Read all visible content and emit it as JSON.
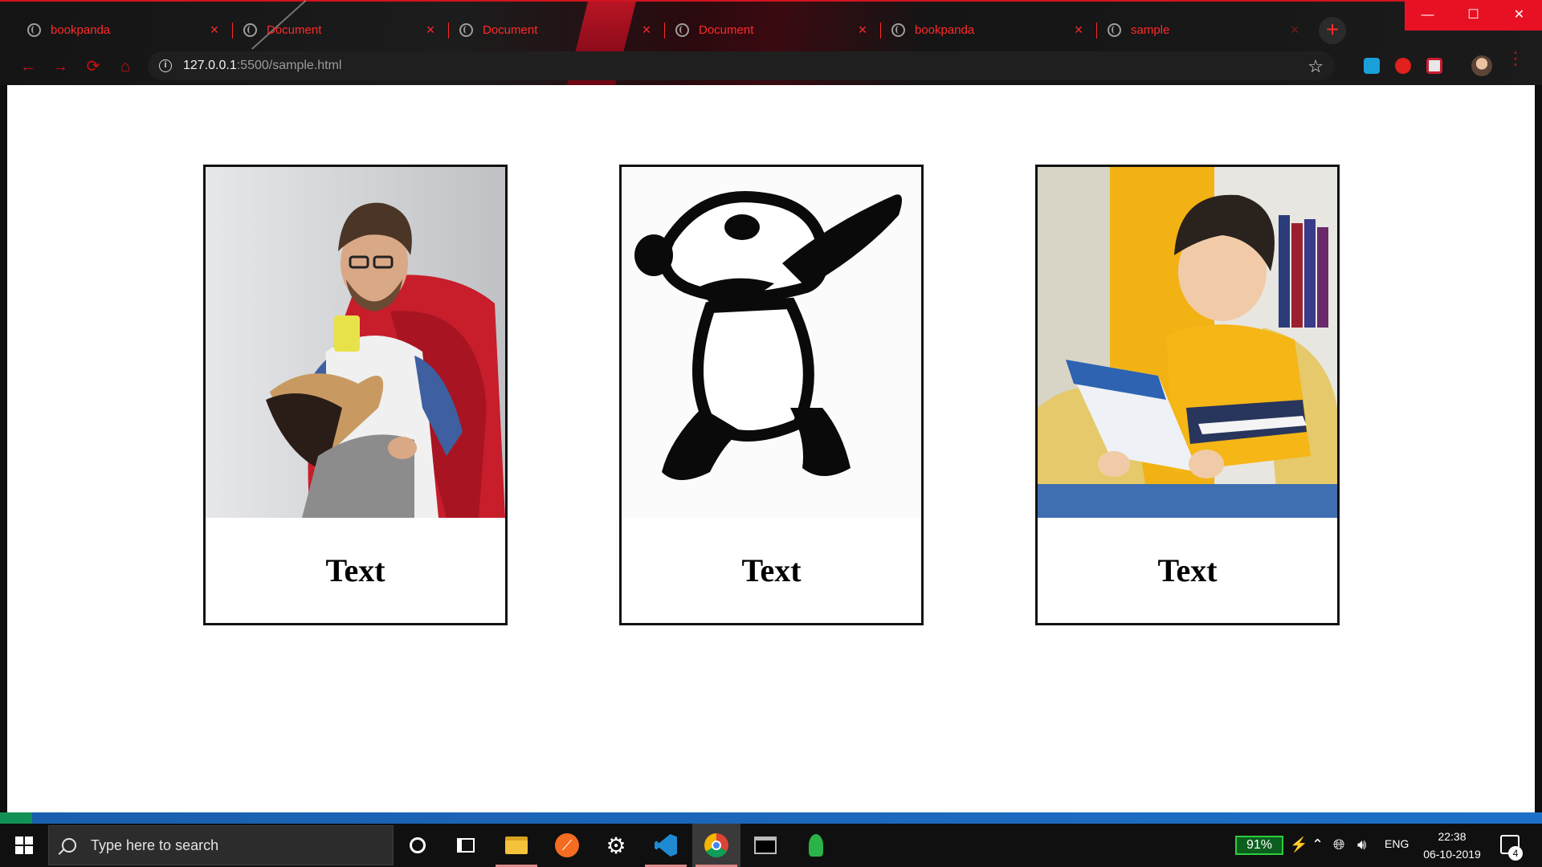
{
  "browser": {
    "tabs": [
      {
        "title": "bookpanda",
        "close": "×"
      },
      {
        "title": "Document",
        "close": "×"
      },
      {
        "title": "Document",
        "close": "×"
      },
      {
        "title": "Document",
        "close": "×"
      },
      {
        "title": "bookpanda",
        "close": "×"
      },
      {
        "title": "sample",
        "close": "×",
        "active": true
      }
    ],
    "new_tab": "+",
    "window_controls": {
      "minimize": "—",
      "maximize": "☐",
      "close": "✕"
    },
    "nav": {
      "back": "←",
      "forward": "→",
      "reload": "⟳",
      "home": "⌂"
    },
    "url": {
      "host": "127.0.0.1",
      "path": ":5500/sample.html",
      "info_icon": "i"
    },
    "bookmark_icon": "☆",
    "menu_icon": "⋮",
    "accent_color": "#ff2a2a"
  },
  "page": {
    "cards": [
      {
        "image": "man-reading-book-with-mug",
        "text": "Text"
      },
      {
        "image": "dabbing-panda-silhouette",
        "text": "Text"
      },
      {
        "image": "boy-reading-book",
        "text": "Text"
      }
    ]
  },
  "taskbar": {
    "search_placeholder": "Type here to search",
    "apps": [
      "cortana-icon",
      "task-view-icon",
      "file-explorer-icon",
      "orange-app-icon",
      "settings-icon",
      "vscode-icon",
      "chrome-icon",
      "terminal-icon",
      "rocket-app-icon"
    ],
    "battery": "91%",
    "language": "ENG",
    "time": "22:38",
    "date": "06-10-2019",
    "notification_count": "4"
  }
}
